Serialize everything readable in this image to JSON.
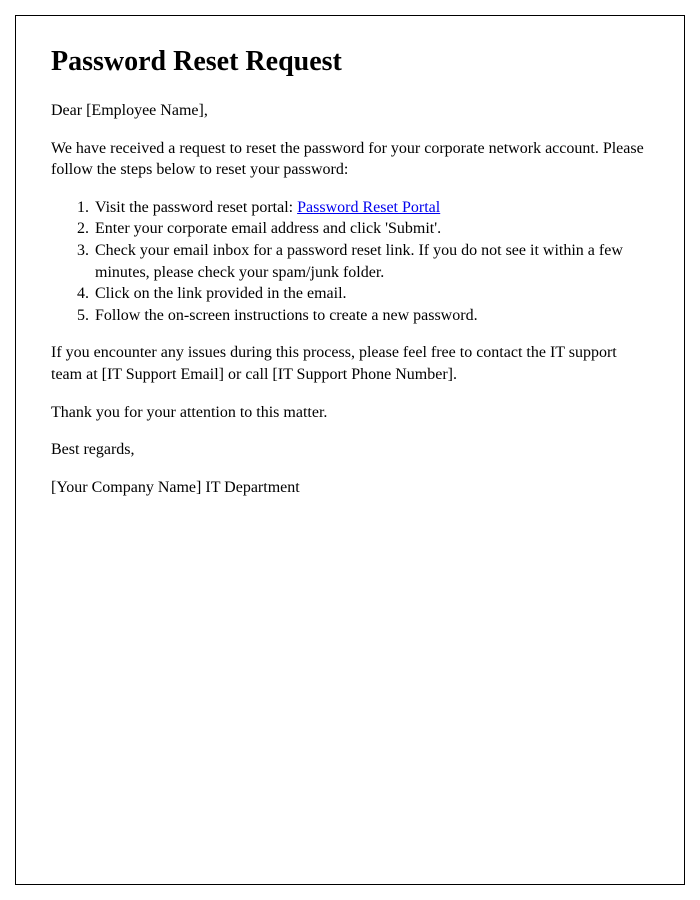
{
  "title": "Password Reset Request",
  "greeting": "Dear [Employee Name],",
  "intro": "We have received a request to reset the password for your corporate network account. Please follow the steps below to reset your password:",
  "steps": {
    "s1_prefix": "Visit the password reset portal: ",
    "s1_link": "Password Reset Portal",
    "s2": "Enter your corporate email address and click 'Submit'.",
    "s3": "Check your email inbox for a password reset link. If you do not see it within a few minutes, please check your spam/junk folder.",
    "s4": "Click on the link provided in the email.",
    "s5": "Follow the on-screen instructions to create a new password."
  },
  "support": "If you encounter any issues during this process, please feel free to contact the IT support team at [IT Support Email] or call [IT Support Phone Number].",
  "thanks": "Thank you for your attention to this matter.",
  "closing": "Best regards,",
  "signature": "[Your Company Name] IT Department"
}
